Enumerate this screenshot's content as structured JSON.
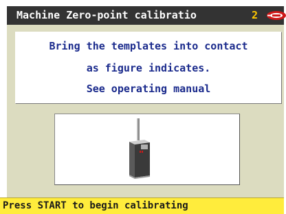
{
  "window": {
    "title": "Machine Zero-point calibratio",
    "step_number": "2",
    "logo_icon": "key-cutter-brand-logo"
  },
  "message": {
    "lines": [
      "Bring the templates into contact",
      "as figure indicates.",
      "See operating manual"
    ]
  },
  "figure": {
    "icon": "calibration-template-figure"
  },
  "status": {
    "text": "Press START to begin calibrating"
  },
  "colors": {
    "title_bar": "#333333",
    "title_text": "#ffffff",
    "step_number": "#ffc800",
    "panel_background": "#dcdcc0",
    "message_text": "#1a2a8c",
    "status_bar": "#ffec3c",
    "logo_red": "#d01818"
  }
}
